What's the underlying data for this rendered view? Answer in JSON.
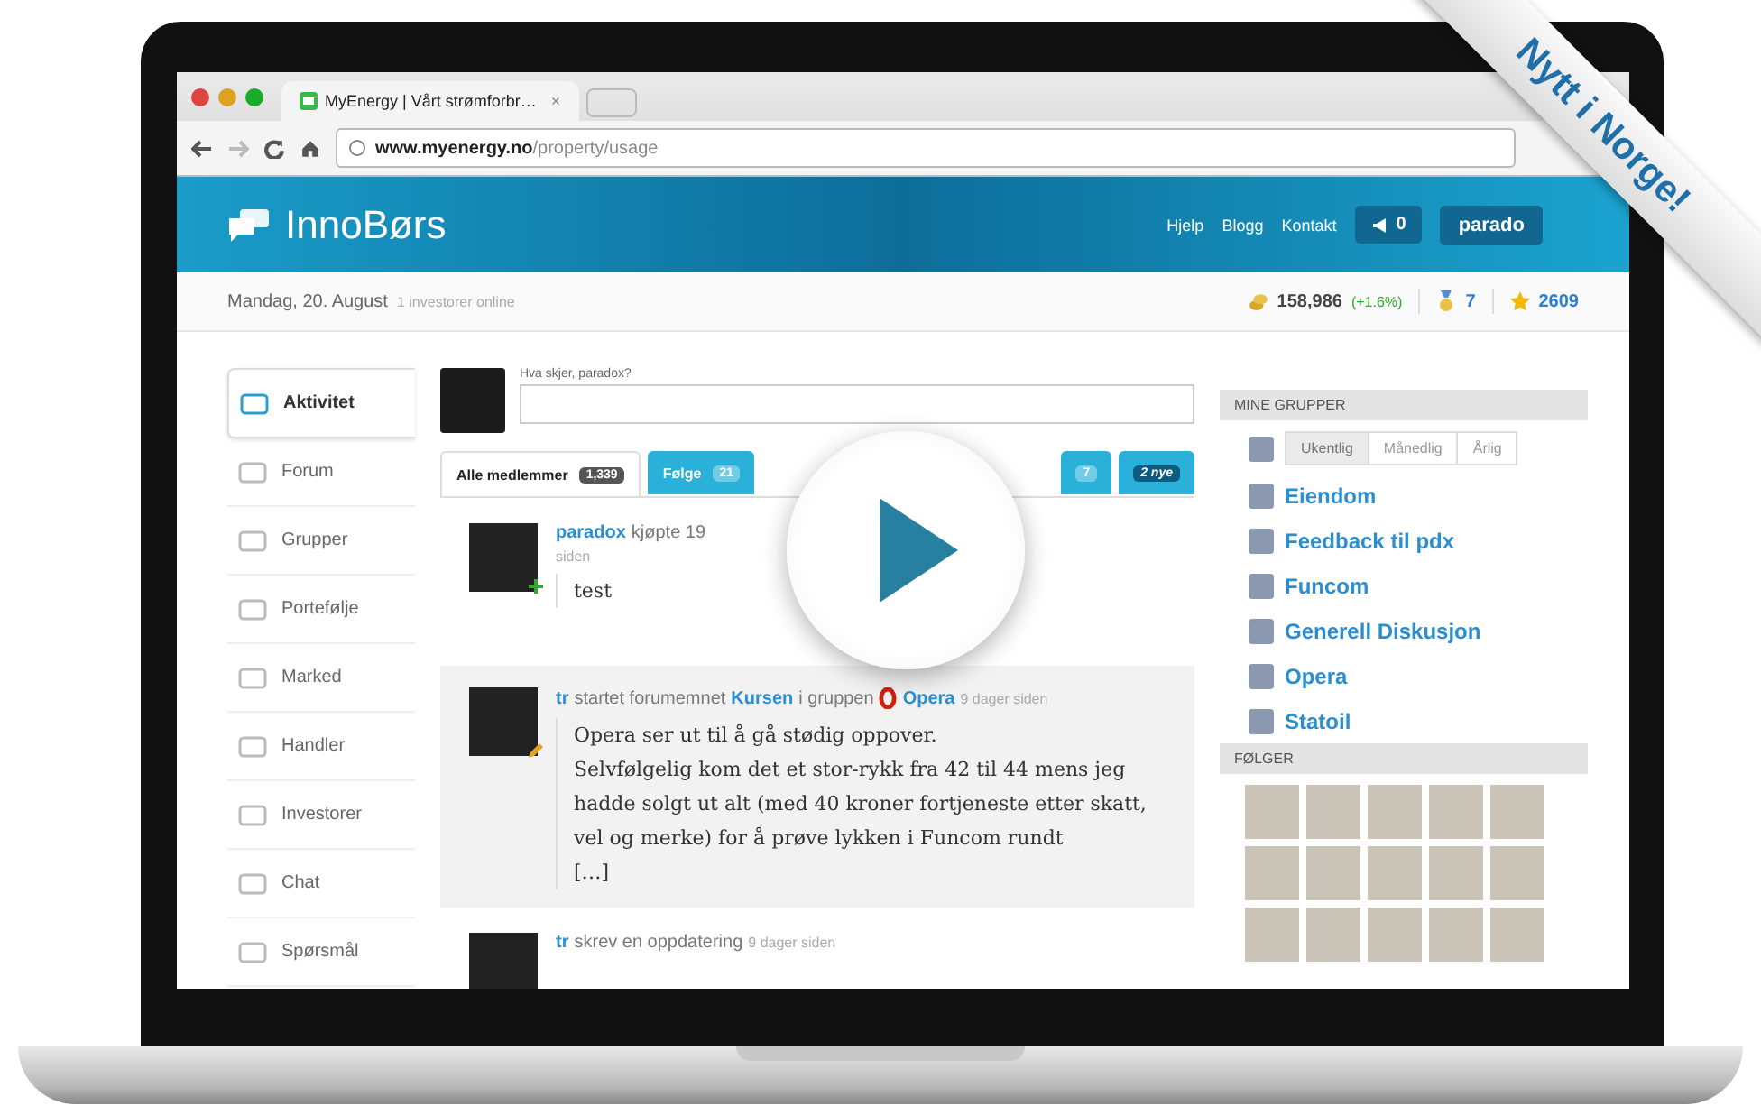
{
  "browser": {
    "tab_title": "MyEnergy | Vårt strømforbr…",
    "close": "×",
    "url_host": "www.myenergy.no",
    "url_path": "/property/usage"
  },
  "header": {
    "logo": "InnoBørs",
    "links": [
      "Hjelp",
      "Blogg",
      "Kontakt"
    ],
    "notifications": "0",
    "user": "parado"
  },
  "subbar": {
    "date": "Mandag, 20. August",
    "online": "1 investorer online",
    "balance": "158,986",
    "change": "(+1.6%)",
    "medals": "7",
    "stars_count": "2609"
  },
  "sidebar": [
    {
      "label": "Aktivitet",
      "selected": true
    },
    {
      "label": "Forum",
      "selected": false
    },
    {
      "label": "Grupper",
      "selected": false
    },
    {
      "label": "Portefølje",
      "selected": false
    },
    {
      "label": "Marked",
      "selected": false
    },
    {
      "label": "Handler",
      "selected": false
    },
    {
      "label": "Investorer",
      "selected": false
    },
    {
      "label": "Chat",
      "selected": false
    },
    {
      "label": "Spørsmål",
      "selected": false
    }
  ],
  "composer": {
    "prompt": "Hva skjer, paradox?"
  },
  "tabs": [
    {
      "label": "Alle medlemmer",
      "count": "1,339",
      "selected": true,
      "kind": "count"
    },
    {
      "label": "Følge",
      "count": "21",
      "selected": false,
      "kind": "count"
    },
    {
      "count": "7",
      "selected": false,
      "kind": "count"
    },
    {
      "count": "2 nye",
      "selected": false,
      "kind": "news"
    }
  ],
  "feed": [
    {
      "actor": "paradox",
      "action": "kjøpte 19",
      "time": "siden",
      "kind": "purchase",
      "body": [
        "test"
      ]
    },
    {
      "actor": "tr",
      "action": "startet forumemnet",
      "topic": "Kursen",
      "connector": "i gruppen",
      "group": "Opera",
      "time": "9 dager siden",
      "kind": "forum",
      "body": [
        "Opera ser ut til å gå stødig oppover.",
        "Selvfølgelig kom det et stor-rykk fra 42 til 44 mens jeg hadde solgt ut alt (med 40 kroner fortjeneste etter skatt, vel og merke) for å prøve lykken i Funcom rundt",
        "[…]"
      ]
    },
    {
      "actor": "tr",
      "action": "skrev en oppdatering",
      "time": "9 dager siden",
      "kind": "update"
    }
  ],
  "groups_panel": {
    "title": "MINE GRUPPER",
    "periods": [
      {
        "label": "Ukentlig",
        "selected": true
      },
      {
        "label": "Månedlig",
        "selected": false
      },
      {
        "label": "Årlig",
        "selected": false
      }
    ],
    "groups": [
      "Eiendom",
      "Feedback til pdx",
      "Funcom",
      "Generell Diskusjon",
      "Opera",
      "Statoil"
    ]
  },
  "following_panel": {
    "title": "FØLGER"
  },
  "ribbon": "Nytt i Norge!"
}
